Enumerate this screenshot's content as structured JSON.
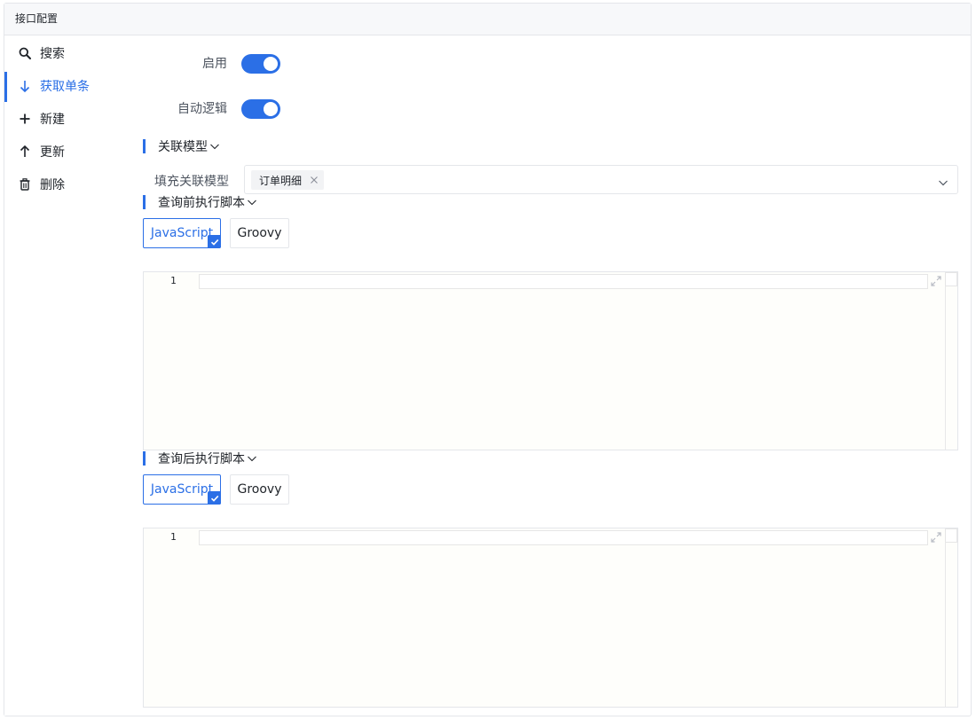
{
  "panel": {
    "title": "接口配置"
  },
  "sidebar": {
    "items": [
      {
        "label": "搜索",
        "icon": "search-icon"
      },
      {
        "label": "获取单条",
        "icon": "arrow-down-icon",
        "active": true
      },
      {
        "label": "新建",
        "icon": "plus-icon"
      },
      {
        "label": "更新",
        "icon": "arrow-up-icon"
      },
      {
        "label": "删除",
        "icon": "trash-icon"
      }
    ]
  },
  "form": {
    "enable_label": "启用",
    "enable_on": true,
    "auto_logic_label": "自动逻辑",
    "auto_logic_on": true
  },
  "relation": {
    "section_title": "关联模型",
    "fill_label": "填充关联模型",
    "selected_tags": [
      "订单明细"
    ]
  },
  "before_script": {
    "section_title": "查询前执行脚本",
    "languages": [
      "JavaScript",
      "Groovy"
    ],
    "selected": "JavaScript",
    "line_numbers": [
      "1"
    ]
  },
  "after_script": {
    "section_title": "查询后执行脚本",
    "languages": [
      "JavaScript",
      "Groovy"
    ],
    "selected": "JavaScript",
    "line_numbers": [
      "1"
    ]
  },
  "colors": {
    "accent": "#2b6fe6",
    "border": "#e4e6ea",
    "editor_bg": "#fefefb"
  }
}
